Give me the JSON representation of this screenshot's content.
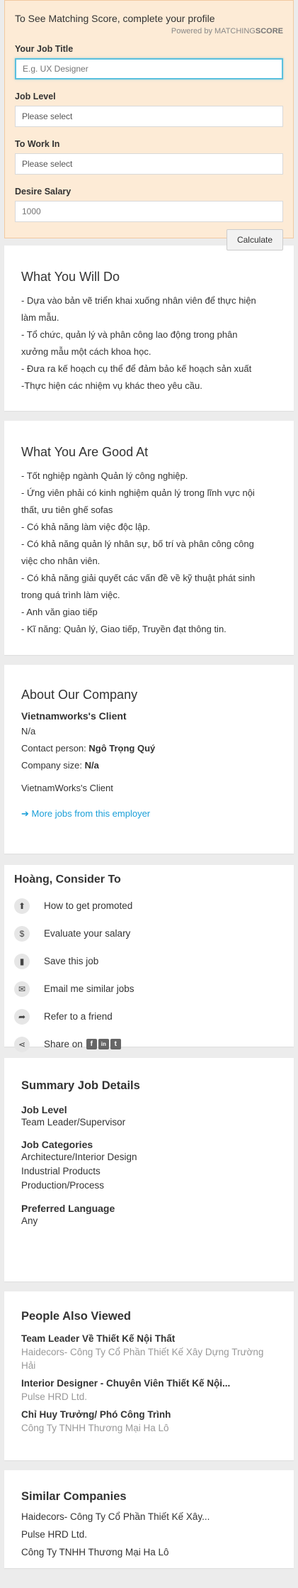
{
  "score": {
    "title": "To See Matching Score, complete your profile",
    "powered_prefix": "Powered by ",
    "powered_brand_a": "MATCHING",
    "powered_brand_b": "SCORE",
    "job_title_label": "Your Job Title",
    "job_title_placeholder": "E.g. UX Designer",
    "job_level_label": "Job Level",
    "job_level_value": "Please select",
    "work_in_label": "To Work In",
    "work_in_value": "Please select",
    "salary_label": "Desire Salary",
    "salary_placeholder": "1000",
    "calculate": "Calculate"
  },
  "what_you_will_do": {
    "title": "What You Will Do",
    "lines": [
      "- Dựa vào bản vẽ triển khai xuống nhân viên để thực hiện",
      "làm mẫu.",
      "- Tổ chức, quản lý và phân công lao động trong phân",
      "xưởng mẫu một cách khoa học.",
      "- Đưa ra kế hoạch cụ thể để đảm bảo kế hoạch sản xuất",
      "-Thực hiện các nhiệm vụ khác theo yêu cầu."
    ]
  },
  "good_at": {
    "title": "What You Are Good At",
    "lines": [
      "- Tốt nghiệp ngành Quản lý công nghiệp.",
      "- Ứng viên phải có kinh nghiệm quản lý trong lĩnh vực nội",
      "thất, ưu tiên ghế sofas",
      "- Có khả năng làm việc độc lập.",
      "- Có khả năng quản lý nhân sự, bố trí và phân công công",
      "việc cho nhân viên.",
      "- Có khả năng giải quyết các vấn đề về kỹ thuật phát sinh",
      "trong quá trình làm việc.",
      "- Anh văn giao tiếp",
      "- Kĩ năng: Quản lý, Giao tiếp, Truyền đạt thông tin."
    ]
  },
  "about": {
    "title": "About Our Company",
    "company_name": "Vietnamworks's Client",
    "address": "N/a",
    "contact_label": "Contact person: ",
    "contact_value": "Ngô Trọng Quý",
    "size_label": "Company size: ",
    "size_value": "N/a",
    "description": "VietnamWorks's Client",
    "more_jobs": "More jobs from this employer"
  },
  "consider": {
    "title": "Hoàng, Consider To",
    "items": [
      {
        "label": "How to get promoted",
        "icon": "arrow-up-circle-icon",
        "glyph": "⬆"
      },
      {
        "label": "Evaluate your salary",
        "icon": "dollar-icon",
        "glyph": "$"
      },
      {
        "label": "Save this job",
        "icon": "bookmark-icon",
        "glyph": "▮"
      },
      {
        "label": "Email me similar jobs",
        "icon": "envelope-icon",
        "glyph": "✉"
      },
      {
        "label": "Refer to a friend",
        "icon": "share-arrow-icon",
        "glyph": "➦"
      },
      {
        "label": "Share on",
        "icon": "share-icon",
        "glyph": "⋖"
      }
    ],
    "social": [
      "f",
      "in",
      "t"
    ]
  },
  "summary": {
    "title": "Summary Job Details",
    "job_level_label": "Job Level",
    "job_level_value": "Team Leader/Supervisor",
    "categories_label": "Job Categories",
    "categories": [
      "Architecture/Interior Design",
      "Industrial Products",
      "Production/Process"
    ],
    "language_label": "Preferred Language",
    "language_value": "Any"
  },
  "people_also_viewed": {
    "title": "People Also Viewed",
    "jobs": [
      {
        "title": "Team Leader Về Thiết Kế Nội Thất",
        "company_line1": "Haidecors- Công Ty Cổ Phần Thiết Kế Xây Dựng Trường",
        "company_line2": "Hải"
      },
      {
        "title": "Interior Designer - Chuyên Viên Thiết Kế Nội...",
        "company_line1": "Pulse HRD Ltd.",
        "company_line2": ""
      },
      {
        "title": "Chỉ Huy Trưởng/ Phó Công Trình",
        "company_line1": "Công Ty TNHH Thương Mại Ha Lô",
        "company_line2": ""
      }
    ]
  },
  "similar_companies": {
    "title": "Similar Companies",
    "items": [
      "Haidecors- Công Ty Cổ Phần Thiết Kế Xây...",
      "Pulse HRD Ltd.",
      "Công Ty TNHH Thương Mại Ha Lô"
    ]
  },
  "colors": {
    "link": "#1a9fd8",
    "score_bg": "#fdebd6",
    "focus": "#5bc0de"
  }
}
